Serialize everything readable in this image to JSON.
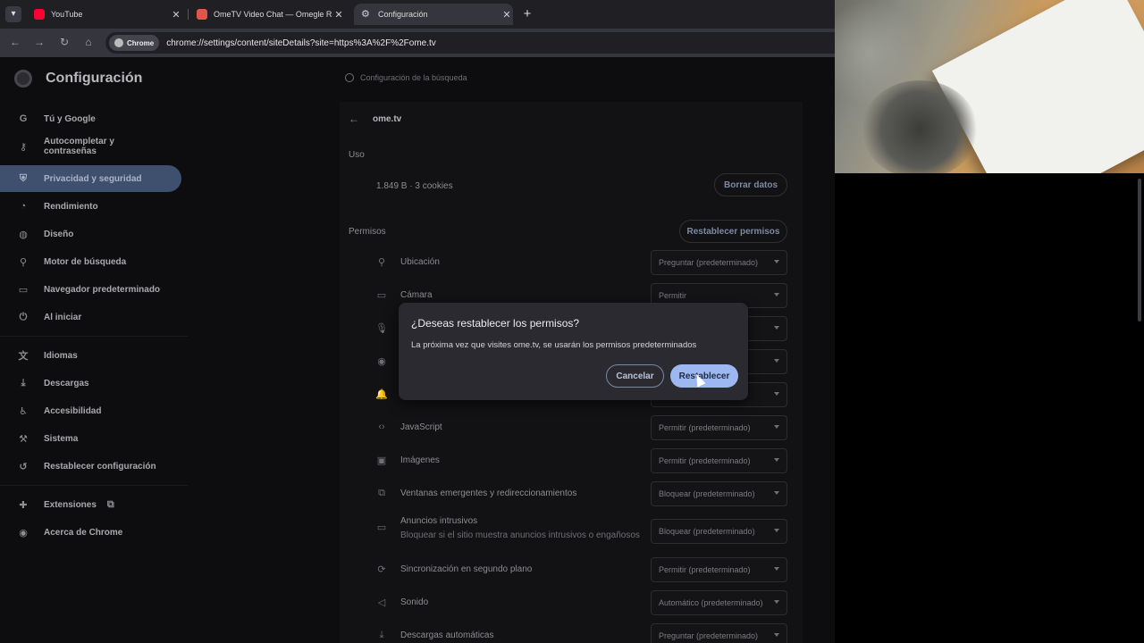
{
  "browser": {
    "tabs": [
      {
        "title": "YouTube",
        "favicon": "youtube-icon",
        "color": "#ff0033"
      },
      {
        "title": "OmeTV Video Chat — Omegle Rando",
        "favicon": "ometv-icon",
        "color": "#e2564a"
      },
      {
        "title": "Configuración",
        "favicon": "settings-gear-icon",
        "color": "#cfcfd4"
      }
    ],
    "chip_label": "Chrome",
    "url": "chrome://settings/content/siteDetails?site=https%3A%2F%2Fome.tv"
  },
  "settings": {
    "title": "Configuración",
    "search_placeholder": "Configuración de la búsqueda",
    "sidebar": {
      "items": [
        {
          "label": "Tú y Google",
          "icon": "google-icon"
        },
        {
          "label": "Autocompletar y contraseñas",
          "icon": "key-icon"
        },
        {
          "label": "Privacidad y seguridad",
          "icon": "shield-icon",
          "selected": true
        },
        {
          "label": "Rendimiento",
          "icon": "speedometer-icon"
        },
        {
          "label": "Diseño",
          "icon": "palette-icon"
        },
        {
          "label": "Motor de búsqueda",
          "icon": "search-icon"
        },
        {
          "label": "Navegador predeterminado",
          "icon": "browser-icon"
        },
        {
          "label": "Al iniciar",
          "icon": "power-icon"
        },
        {
          "label": "Idiomas",
          "icon": "translate-icon"
        },
        {
          "label": "Descargas",
          "icon": "download-icon"
        },
        {
          "label": "Accesibilidad",
          "icon": "accessibility-icon"
        },
        {
          "label": "Sistema",
          "icon": "wrench-icon"
        },
        {
          "label": "Restablecer configuración",
          "icon": "reset-icon"
        },
        {
          "label": "Extensiones",
          "icon": "puzzle-icon"
        },
        {
          "label": "Acerca de Chrome",
          "icon": "chrome-icon"
        }
      ]
    },
    "site": "ome.tv",
    "usage": {
      "label": "Uso",
      "summary": "1.849 B · 3 cookies",
      "clear_button": "Borrar datos"
    },
    "permissions": {
      "label": "Permisos",
      "reset_button": "Restablecer permisos",
      "items": [
        {
          "label": "Ubicación",
          "icon": "location-icon",
          "value": "Preguntar (predeterminado)"
        },
        {
          "label": "Cámara",
          "icon": "camera-icon",
          "value": "Permitir"
        },
        {
          "label": "",
          "icon": "microphone-icon",
          "value": ""
        },
        {
          "label": "",
          "icon": "sensors-icon",
          "value": ""
        },
        {
          "label": "",
          "icon": "bell-icon",
          "value": ""
        },
        {
          "label": "JavaScript",
          "icon": "code-icon",
          "value": "Permitir (predeterminado)"
        },
        {
          "label": "Imágenes",
          "icon": "image-icon",
          "value": "Permitir (predeterminado)"
        },
        {
          "label": "Ventanas emergentes y redireccionamientos",
          "icon": "popup-icon",
          "value": "Bloquear (predeterminado)"
        },
        {
          "label": "Anuncios intrusivos",
          "sublabel": "Bloquear si el sitio muestra anuncios intrusivos o engañosos",
          "icon": "ads-icon",
          "value": "Bloquear (predeterminado)"
        },
        {
          "label": "Sincronización en segundo plano",
          "icon": "sync-icon",
          "value": "Permitir (predeterminado)"
        },
        {
          "label": "Sonido",
          "icon": "speaker-icon",
          "value": "Automático (predeterminado)"
        },
        {
          "label": "Descargas automáticas",
          "icon": "download-icon",
          "value": "Preguntar (predeterminado)"
        }
      ]
    }
  },
  "dialog": {
    "title": "¿Deseas restablecer los permisos?",
    "body": "La próxima vez que visites ome.tv, se usarán los permisos predeterminados",
    "cancel": "Cancelar",
    "confirm": "Restablecer"
  },
  "colors": {
    "accent": "#9db8f0",
    "selected_nav": "#3f4f6e"
  }
}
